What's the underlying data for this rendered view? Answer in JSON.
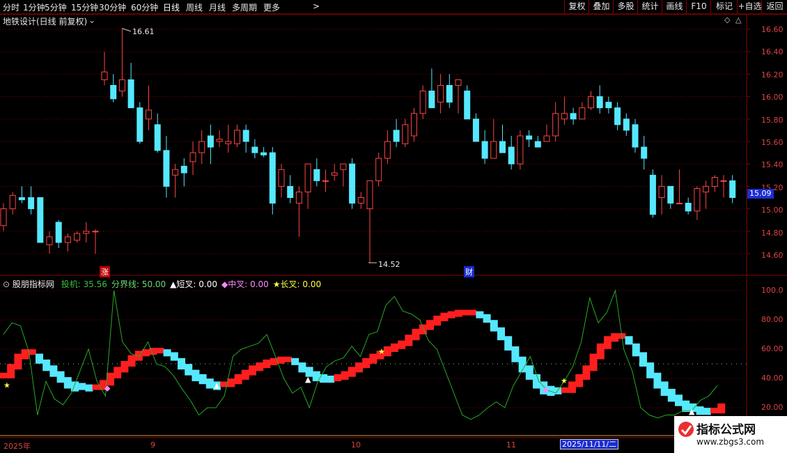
{
  "toolbar": {
    "periods": [
      "分时",
      "1分钟",
      "5分钟",
      "15分钟",
      "30分钟",
      "60分钟",
      "日线",
      "周线",
      "月线",
      "多周期",
      "更多"
    ],
    "more_arrow": ">",
    "buttons": [
      "复权",
      "叠加",
      "多股",
      "统计",
      "画线",
      "F10",
      "标记",
      "+自选",
      "返回"
    ]
  },
  "main_panel": {
    "title": "地铁设计(日线 前复权)",
    "high_label": "16.61",
    "low_label": "14.52",
    "current_price": "15.09",
    "marker_zhang": "涨",
    "marker_cai": "财",
    "yaxis": [
      "16.60",
      "16.40",
      "16.20",
      "16.00",
      "15.80",
      "15.60",
      "15.40",
      "15.20",
      "15.00",
      "14.80",
      "14.60"
    ],
    "colors": {
      "up": "#ff4444",
      "down": "#55e8ff",
      "grid": "#8b0000"
    }
  },
  "indicator_panel": {
    "name": "股朋指标网",
    "items": [
      {
        "label": "投机:",
        "value": "35.56",
        "color": "#3cbf3c"
      },
      {
        "label": "分界线:",
        "value": "50.00",
        "color": "#6fd66f"
      },
      {
        "label": "▲短叉:",
        "value": "0.00",
        "color": "#ffffff"
      },
      {
        "label": "◆中叉:",
        "value": "0.00",
        "color": "#ff88ff"
      },
      {
        "label": "★长叉:",
        "value": "0.00",
        "color": "#ffff44"
      }
    ],
    "yaxis": [
      "100.0",
      "80.00",
      "60.00",
      "40.00",
      "20.00"
    ]
  },
  "date_axis": {
    "labels": [
      "2025年",
      "9",
      "10",
      "11"
    ],
    "cursor_date": "2025/11/11/二"
  },
  "watermark": {
    "title": "指标公式网",
    "url": "www.zbgs3.com"
  },
  "chart_data": {
    "type": "candlestick",
    "price_high": 16.61,
    "price_low": 14.52,
    "current": 15.09,
    "indicator_scale": [
      0,
      100
    ],
    "boundary_line": 50
  }
}
